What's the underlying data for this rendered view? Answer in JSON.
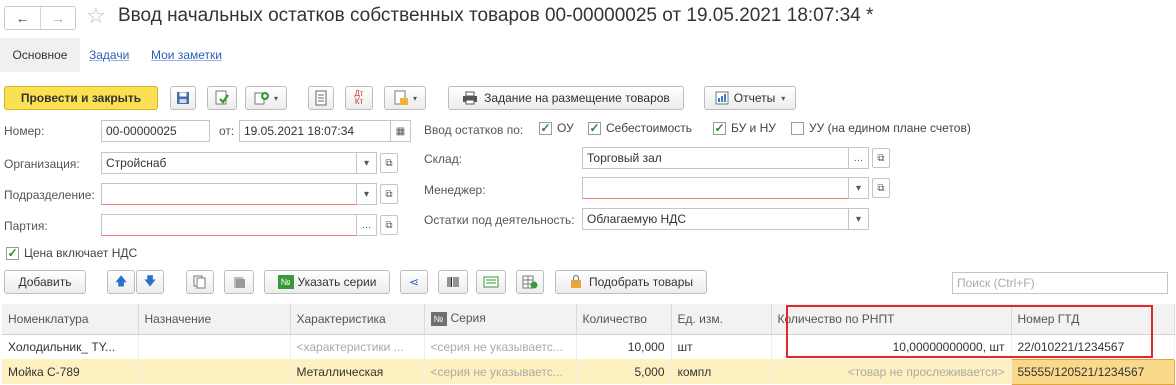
{
  "header": {
    "title": "Ввод начальных остатков собственных товаров 00-00000025 от 19.05.2021 18:07:34 *",
    "back_glyph": "←",
    "forward_glyph": "→",
    "star_glyph": "☆"
  },
  "tabs": [
    {
      "label": "Основное",
      "active": true
    },
    {
      "label": "Задачи"
    },
    {
      "label": "Мои заметки"
    }
  ],
  "toolbar": {
    "post_close_label": "Провести и закрыть",
    "placement_task_label": "Задание на размещение товаров",
    "reports_label": "Отчеты",
    "dt_kt_label": "Дт\nКт",
    "icons": [
      "save-icon",
      "post-icon",
      "create-based-on-icon",
      "document-list-icon",
      "dt-kt-icon",
      "print-icon",
      "printer-icon",
      "reports-icon"
    ]
  },
  "form": {
    "number_label": "Номер:",
    "number_value": "00-00000025",
    "date_label": "от:",
    "date_value": "19.05.2021 18:07:34",
    "org_label": "Организация:",
    "org_value": "Стройснаб",
    "dept_label": "Подразделение:",
    "dept_value": "",
    "batch_label": "Партия:",
    "batch_value": "",
    "price_vat_label": "Цена включает НДС",
    "price_vat_checked": true,
    "balance_input_label": "Ввод остатков по:",
    "chk_ou": "ОУ",
    "chk_cost": "Себестоимость",
    "chk_bu_nu": "БУ и НУ",
    "chk_uu": "УУ (на едином плане счетов)",
    "warehouse_label": "Склад:",
    "warehouse_value": "Торговый зал",
    "manager_label": "Менеджер:",
    "manager_value": "",
    "activity_label": "Остатки под деятельность:",
    "activity_value": "Облагаемую НДС"
  },
  "table_toolbar": {
    "add_label": "Добавить",
    "series_label": "Указать серии",
    "pick_goods_label": "Подобрать товары",
    "search_placeholder": "Поиск (Ctrl+F)"
  },
  "table": {
    "columns": [
      "Номенклатура",
      "Назначение",
      "Характеристика",
      "Серия",
      "Количество",
      "Ед. изм.",
      "Количество по РНПТ",
      "Номер ГТД"
    ],
    "rows": [
      {
        "nomenclature": "Холодильник_ TY...",
        "purpose": "",
        "characteristic": "<характеристики ...",
        "series": "<серия не указываетс...",
        "quantity": "10,000",
        "unit": "шт",
        "rnpt_qty": "10,00000000000, шт",
        "gtd": "22/010221/1234567",
        "selected": false
      },
      {
        "nomenclature": "Мойка С-789",
        "purpose": "",
        "characteristic": "Металлическая",
        "series": "<серия не указываетс...",
        "quantity": "5,000",
        "unit": "компл",
        "rnpt_qty": "<товар не прослеживается>",
        "gtd": "55555/120521/1234567",
        "selected": true
      }
    ]
  },
  "colors": {
    "primary_button": "#fce053",
    "link": "#2c5fb8",
    "highlight_frame": "#e02a2a",
    "selected_row": "#fdf0c1",
    "gtd_cell": "#fbd98a"
  }
}
